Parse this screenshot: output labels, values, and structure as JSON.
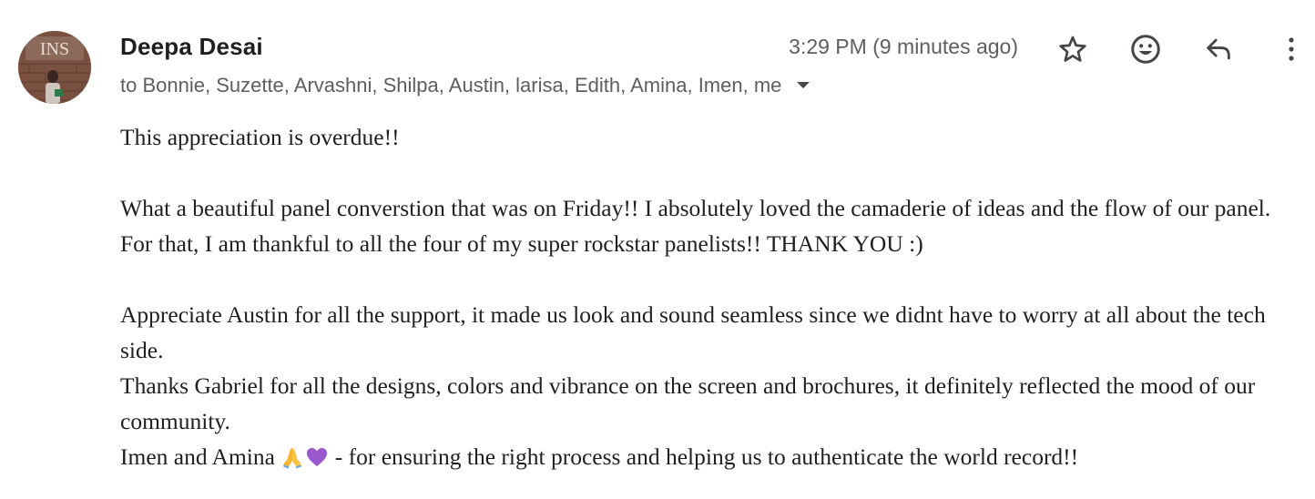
{
  "email": {
    "sender_name": "Deepa Desai",
    "recipients_line": "to Bonnie, Suzette, Arvashni, Shilpa, Austin, larisa, Edith, Amina, Imen, me",
    "timestamp": "3:29 PM (9 minutes ago)",
    "avatar_sign_text": "INS",
    "body": {
      "line1": "This appreciation is overdue!!",
      "para2": "What a beautiful panel converstion that was on Friday!! I absolutely loved the camaderie of ideas and the flow of our panel. For that, I am thankful to all the four of my super rockstar panelists!! THANK YOU :)",
      "para3a": "Appreciate Austin for all the support, it made us look and sound seamless since we didnt have to worry at all about the tech side.",
      "para3b": "Thanks Gabriel for all the designs, colors and vibrance on the screen and brochures, it definitely reflected the mood of our community.",
      "para3c_prefix": "Imen and Amina ",
      "para3c_suffix": " - for ensuring the right process and helping us to authenticate the world record!!",
      "emojis": [
        "folded-hands-emoji",
        "purple-heart-emoji"
      ]
    }
  },
  "actions": {
    "star_icon": "star-icon",
    "emoji_icon": "add-reaction-icon",
    "reply_icon": "reply-icon",
    "more_icon": "more-vert-icon",
    "recipients_toggle_icon": "caret-down-icon"
  },
  "colors": {
    "text_primary": "#1f1f1f",
    "text_secondary": "#5e5e5e",
    "icon": "#444746",
    "heart": "#9b59d0"
  }
}
